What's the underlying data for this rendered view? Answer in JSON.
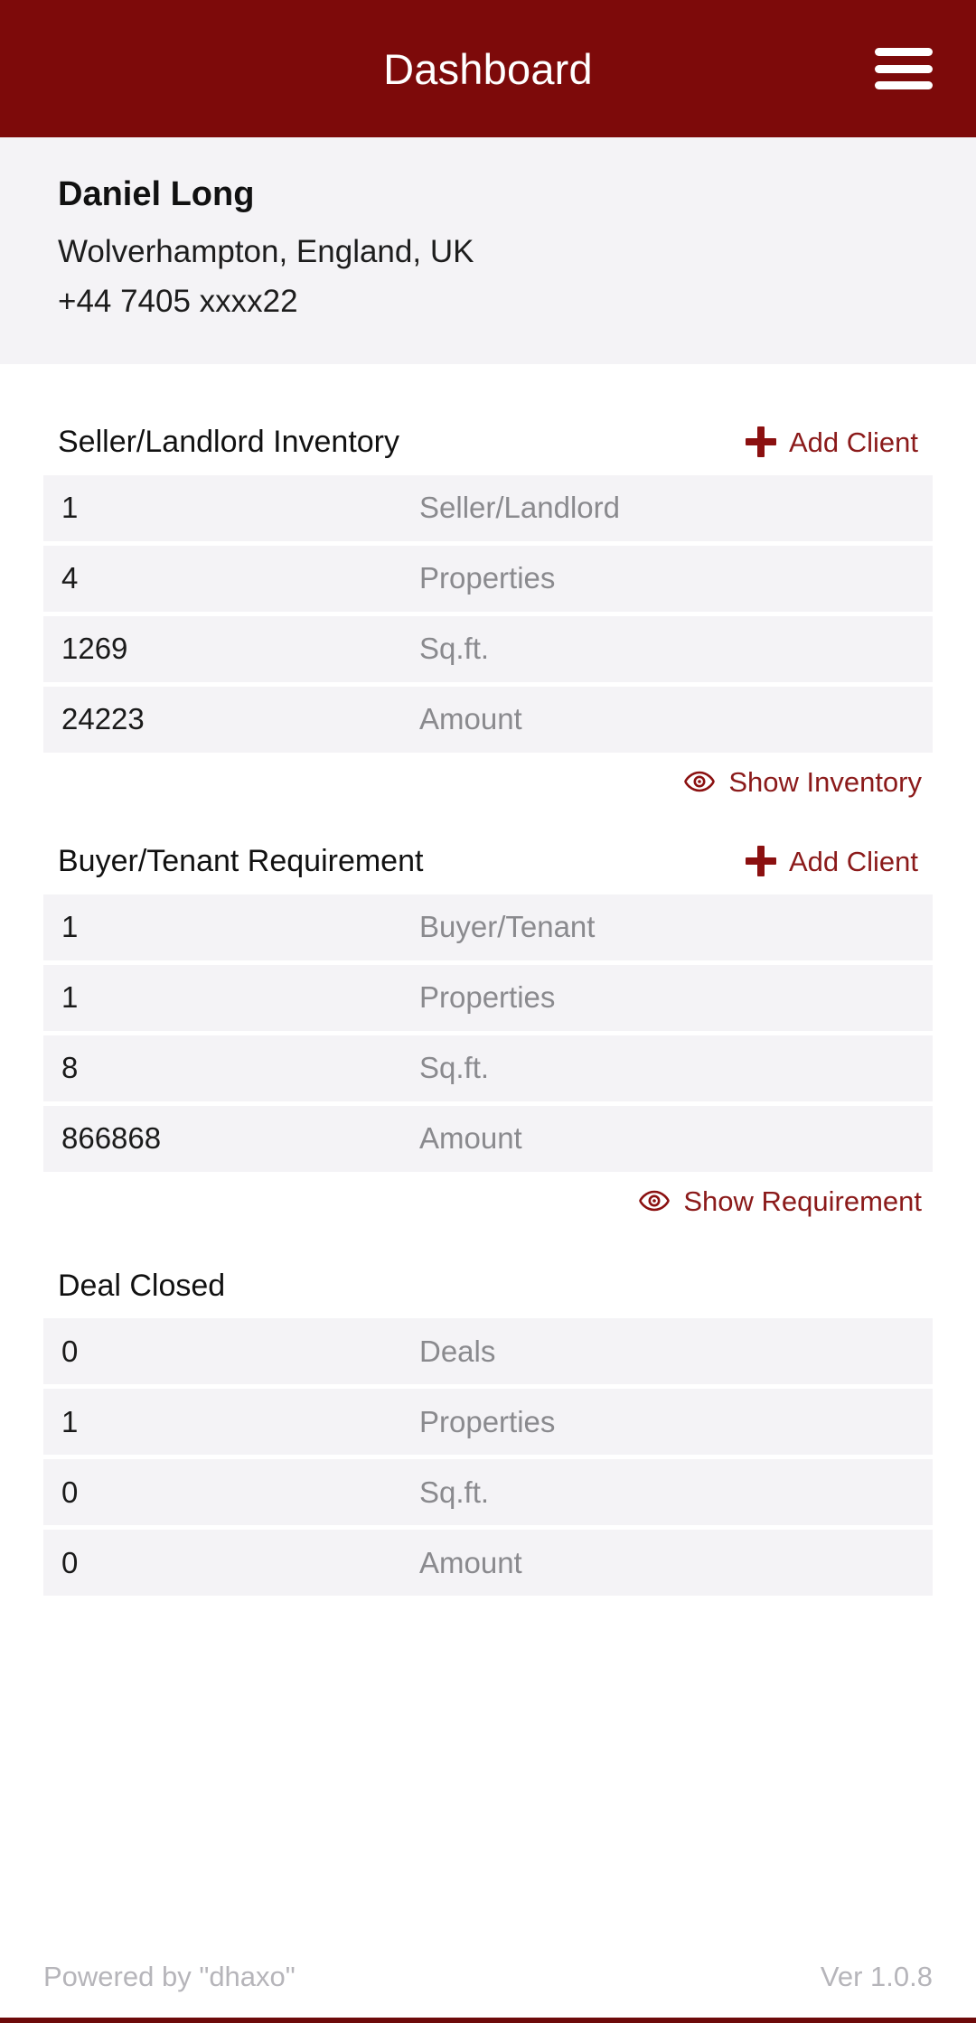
{
  "appbar": {
    "title": "Dashboard",
    "menu_icon": "hamburger-menu-icon"
  },
  "profile": {
    "name": "Daniel Long",
    "location": "Wolverhampton, England, UK",
    "phone": "+44 7405 xxxx22"
  },
  "sections": [
    {
      "title": "Seller/Landlord Inventory",
      "add_client_label": "Add Client",
      "add_icon": "plus-icon",
      "rows": [
        {
          "value": "1",
          "label": "Seller/Landlord"
        },
        {
          "value": "4",
          "label": "Properties"
        },
        {
          "value": "1269",
          "label": "Sq.ft."
        },
        {
          "value": "24223",
          "label": "Amount"
        }
      ],
      "show_link_label": "Show Inventory",
      "show_link_icon": "eye-icon"
    },
    {
      "title": "Buyer/Tenant Requirement",
      "add_client_label": "Add Client",
      "add_icon": "plus-icon",
      "rows": [
        {
          "value": "1",
          "label": "Buyer/Tenant"
        },
        {
          "value": "1",
          "label": "Properties"
        },
        {
          "value": "8",
          "label": "Sq.ft."
        },
        {
          "value": "866868",
          "label": "Amount"
        }
      ],
      "show_link_label": "Show Requirement",
      "show_link_icon": "eye-icon"
    },
    {
      "title": "Deal Closed",
      "rows": [
        {
          "value": "0",
          "label": "Deals"
        },
        {
          "value": "1",
          "label": "Properties"
        },
        {
          "value": "0",
          "label": "Sq.ft."
        },
        {
          "value": "0",
          "label": "Amount"
        }
      ]
    }
  ],
  "footer": {
    "powered_by": "Powered by \"dhaxo\"",
    "version": "Ver 1.0.8"
  },
  "colors": {
    "brand": "#7d0a0a",
    "brand_dark": "#6d0a0a",
    "accent_link": "#8b1a1a",
    "row_bg": "#f4f3f6",
    "profile_bg": "#f4f3f6",
    "label_gray": "#8a8a8e",
    "footer_gray": "#b6b5ba"
  }
}
